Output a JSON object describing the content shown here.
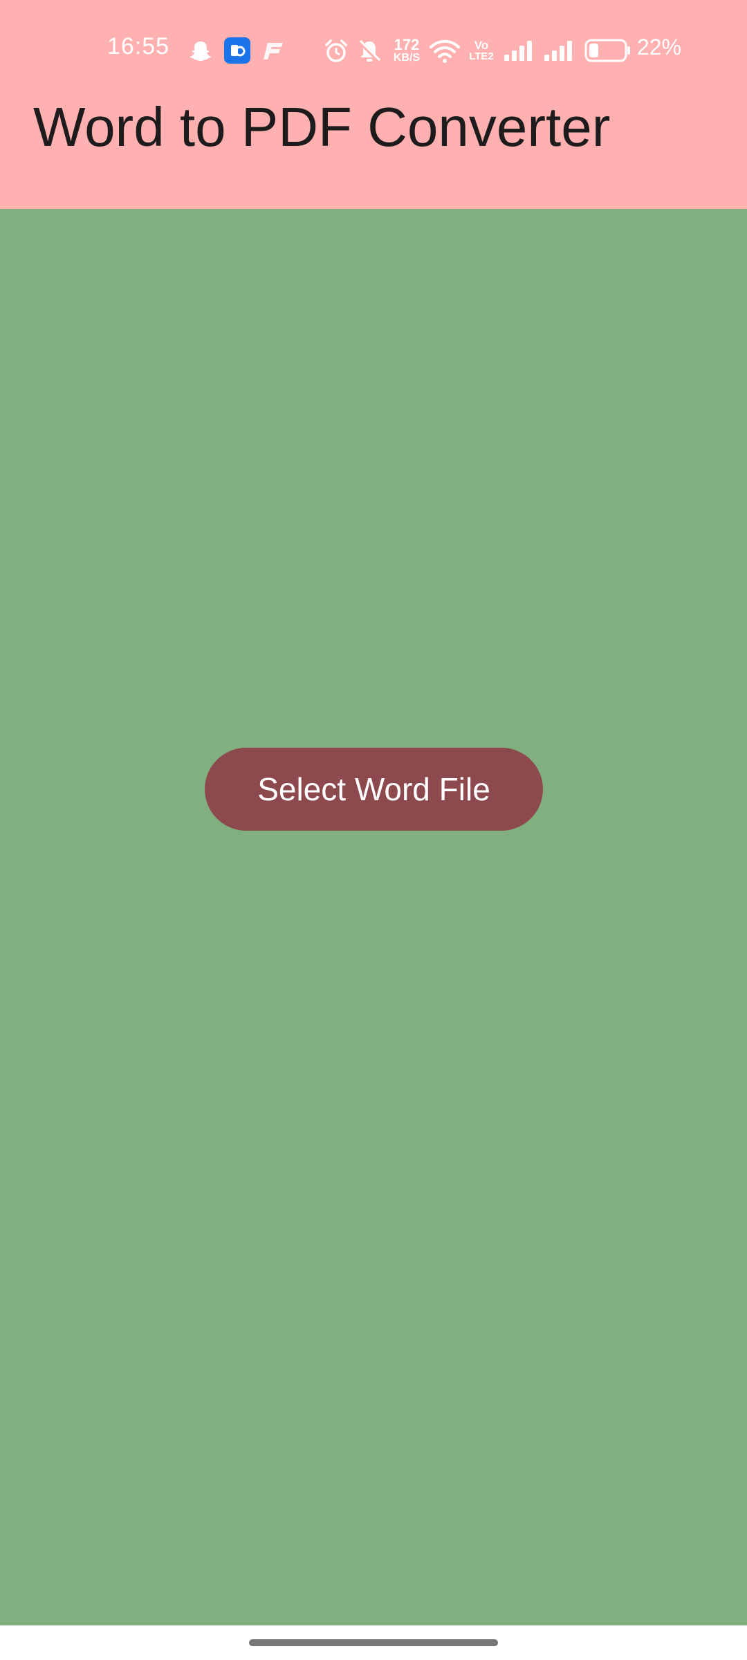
{
  "status_bar": {
    "time": "16:55",
    "net_speed_value": "172",
    "net_speed_unit": "KB/S",
    "volte_top": "Vo",
    "volte_bottom": "LTE2",
    "battery_percent": "22%",
    "battery_level": 0.22,
    "icons": [
      "snapchat-icon",
      "app-badge-icon",
      "f-app-icon",
      "alarm-icon",
      "bell-off-icon",
      "wifi-icon",
      "signal-icon-1",
      "signal-icon-2",
      "battery-icon"
    ]
  },
  "app_bar": {
    "title": "Word to PDF Converter"
  },
  "main": {
    "select_button_label": "Select Word File"
  },
  "colors": {
    "header_background": "#ffb0b0",
    "content_background": "#82af80",
    "button_background": "#8d4a4e",
    "button_text": "#ffffff",
    "title_text": "#1d1b1c"
  }
}
